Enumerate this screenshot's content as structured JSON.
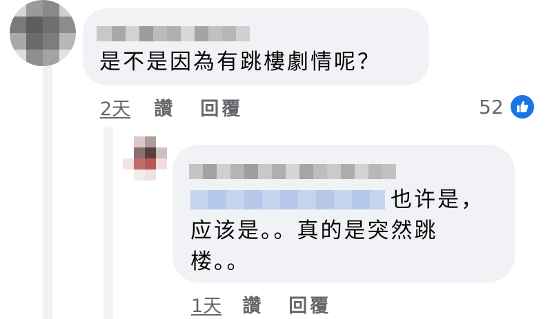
{
  "comment": {
    "author_name": "",
    "text": "是不是因為有跳樓劇情呢？",
    "time": "2天",
    "like_label": "讚",
    "reply_label": "回覆",
    "reaction_count": "52",
    "reaction_icon": "thumbs-up-icon",
    "colors": {
      "bubble": "#f0f2f5",
      "meta_text": "#65676b",
      "like_badge": "#1b74e4"
    }
  },
  "reply": {
    "author_name": "",
    "mention_name": "",
    "text": "也许是，应该是。。真的是突然跳楼。。",
    "time": "1天",
    "like_label": "讚",
    "reply_label": "回覆"
  }
}
